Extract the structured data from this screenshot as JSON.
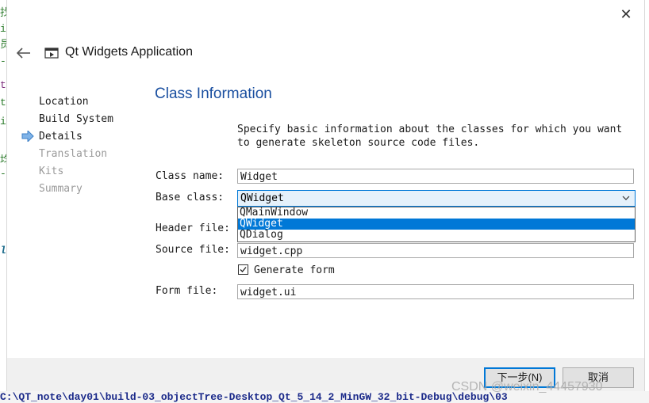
{
  "window": {
    "title": "Qt Widgets Application",
    "close_glyph": "✕"
  },
  "steps": [
    {
      "label": "Location",
      "state": "done"
    },
    {
      "label": "Build System",
      "state": "done"
    },
    {
      "label": "Details",
      "state": "current"
    },
    {
      "label": "Translation",
      "state": "disabled"
    },
    {
      "label": "Kits",
      "state": "disabled"
    },
    {
      "label": "Summary",
      "state": "disabled"
    }
  ],
  "page": {
    "title": "Class Information",
    "description_line1": "Specify basic information about the classes for which you want",
    "description_line2": "to generate skeleton source code files."
  },
  "form": {
    "class_name_label": "Class name:",
    "class_name_value": "Widget",
    "base_class_label": "Base class:",
    "base_class_value": "QWidget",
    "base_class_options": [
      "QMainWindow",
      "QWidget",
      "QDialog"
    ],
    "base_class_selected_index": 1,
    "header_file_label": "Header file:",
    "source_file_label": "Source file:",
    "source_file_value": "widget.cpp",
    "generate_form_label": "Generate form",
    "generate_form_checked": true,
    "form_file_label": "Form file:",
    "form_file_value": "widget.ui"
  },
  "buttons": {
    "next": "下一步(N)",
    "cancel": "取消"
  },
  "background": {
    "left_chars": [
      "找",
      "i",
      "员",
      "-",
      "t",
      "t",
      "ie",
      "均",
      "-",
      "le"
    ],
    "bottom_path": "C:\\QT_note\\day01\\build-03_objectTree-Desktop_Qt_5_14_2_MinGW_32_bit-Debug\\debug\\03"
  },
  "watermark": "CSDN @weixin_44457930",
  "colors": {
    "accent": "#0078d7",
    "page_title": "#1a4fa0"
  }
}
